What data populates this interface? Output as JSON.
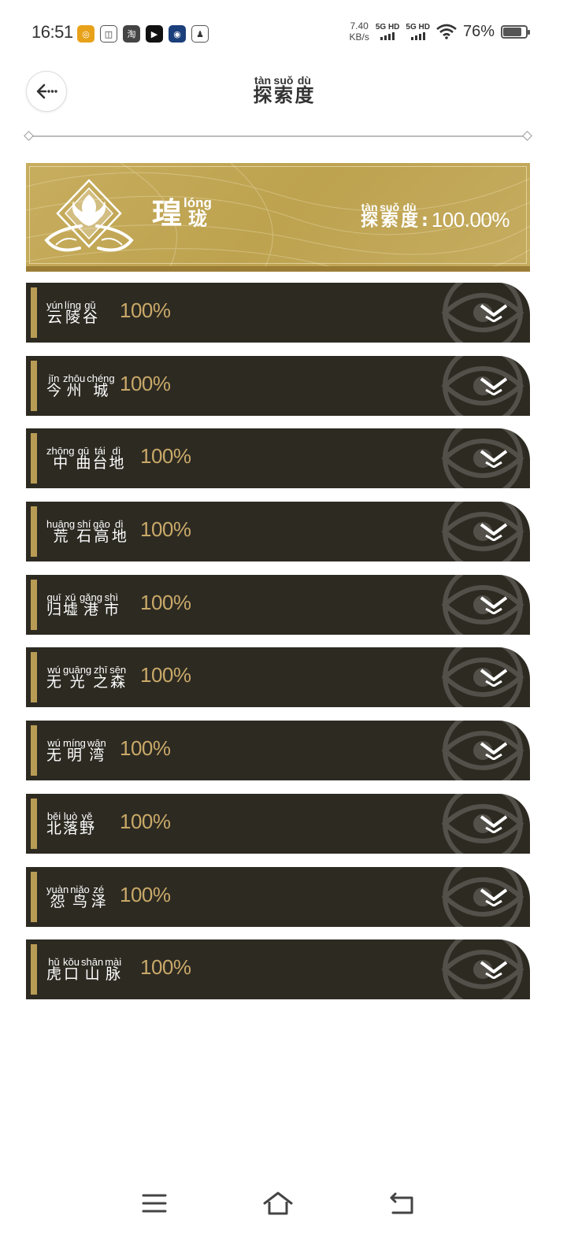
{
  "status_bar": {
    "time": "16:51",
    "app_icons": [
      {
        "name": "orange-app-icon",
        "glyph": "◎",
        "color": "#e8a21a"
      },
      {
        "name": "tv-app-icon",
        "glyph": "◫",
        "color": "#ffffff"
      },
      {
        "name": "taobao-app-icon",
        "glyph": "淘",
        "color": "#444444"
      },
      {
        "name": "video-app-icon",
        "glyph": "▶",
        "color": "#111111"
      },
      {
        "name": "blue-app-icon",
        "glyph": "◉",
        "color": "#1b3f7a"
      },
      {
        "name": "qq-app-icon",
        "glyph": "♟",
        "color": "#ffffff"
      }
    ],
    "speed_value": "7.40",
    "speed_unit": "KB/s",
    "sim1_label": "5G HD",
    "sim2_label": "5G HD",
    "battery_percent": "76%",
    "battery_level": 0.76
  },
  "header": {
    "title_chars": [
      {
        "py": "tàn",
        "hz": "探"
      },
      {
        "py": "suǒ",
        "hz": "索"
      },
      {
        "py": "dù",
        "hz": "度"
      }
    ]
  },
  "region": {
    "name_char": "瑝",
    "name_small_py": "lóng",
    "name_small_hz": "珑",
    "progress_chars": [
      {
        "py": "tàn",
        "hz": "探"
      },
      {
        "py": "suǒ",
        "hz": "索"
      },
      {
        "py": "dù",
        "hz": "度"
      }
    ],
    "colon": ":",
    "progress": "100.00%"
  },
  "areas": [
    {
      "chars": [
        {
          "py": "yún",
          "hz": "云"
        },
        {
          "py": "líng",
          "hz": "陵"
        },
        {
          "py": "gǔ",
          "hz": "谷"
        }
      ],
      "percent": "100%"
    },
    {
      "chars": [
        {
          "py": "jīn",
          "hz": "今"
        },
        {
          "py": "zhōu",
          "hz": "州"
        },
        {
          "py": "chéng",
          "hz": "城"
        }
      ],
      "percent": "100%"
    },
    {
      "chars": [
        {
          "py": "zhōng",
          "hz": "中"
        },
        {
          "py": "qū",
          "hz": "曲"
        },
        {
          "py": "tái",
          "hz": "台"
        },
        {
          "py": "dì",
          "hz": "地"
        }
      ],
      "percent": "100%"
    },
    {
      "chars": [
        {
          "py": "huāng",
          "hz": "荒"
        },
        {
          "py": "shí",
          "hz": "石"
        },
        {
          "py": "gāo",
          "hz": "高"
        },
        {
          "py": "dì",
          "hz": "地"
        }
      ],
      "percent": "100%"
    },
    {
      "chars": [
        {
          "py": "guī",
          "hz": "归"
        },
        {
          "py": "xū",
          "hz": "墟"
        },
        {
          "py": "gǎng",
          "hz": "港"
        },
        {
          "py": "shì",
          "hz": "市"
        }
      ],
      "percent": "100%"
    },
    {
      "chars": [
        {
          "py": "wú",
          "hz": "无"
        },
        {
          "py": "guāng",
          "hz": "光"
        },
        {
          "py": "zhī",
          "hz": "之"
        },
        {
          "py": "sēn",
          "hz": "森"
        }
      ],
      "percent": "100%"
    },
    {
      "chars": [
        {
          "py": "wú",
          "hz": "无"
        },
        {
          "py": "míng",
          "hz": "明"
        },
        {
          "py": "wān",
          "hz": "湾"
        }
      ],
      "percent": "100%"
    },
    {
      "chars": [
        {
          "py": "běi",
          "hz": "北"
        },
        {
          "py": "luò",
          "hz": "落"
        },
        {
          "py": "yě",
          "hz": "野"
        }
      ],
      "percent": "100%"
    },
    {
      "chars": [
        {
          "py": "yuàn",
          "hz": "怨"
        },
        {
          "py": "niǎo",
          "hz": "鸟"
        },
        {
          "py": "zé",
          "hz": "泽"
        }
      ],
      "percent": "100%"
    },
    {
      "chars": [
        {
          "py": "hǔ",
          "hz": "虎"
        },
        {
          "py": "kǒu",
          "hz": "口"
        },
        {
          "py": "shān",
          "hz": "山"
        },
        {
          "py": "mài",
          "hz": "脉"
        }
      ],
      "percent": "100%"
    }
  ],
  "colors": {
    "banner_gold": "#c7ad5e",
    "item_dark": "#2d2a22",
    "accent_gold": "#b89b55",
    "percent_gold": "#c9a968"
  }
}
